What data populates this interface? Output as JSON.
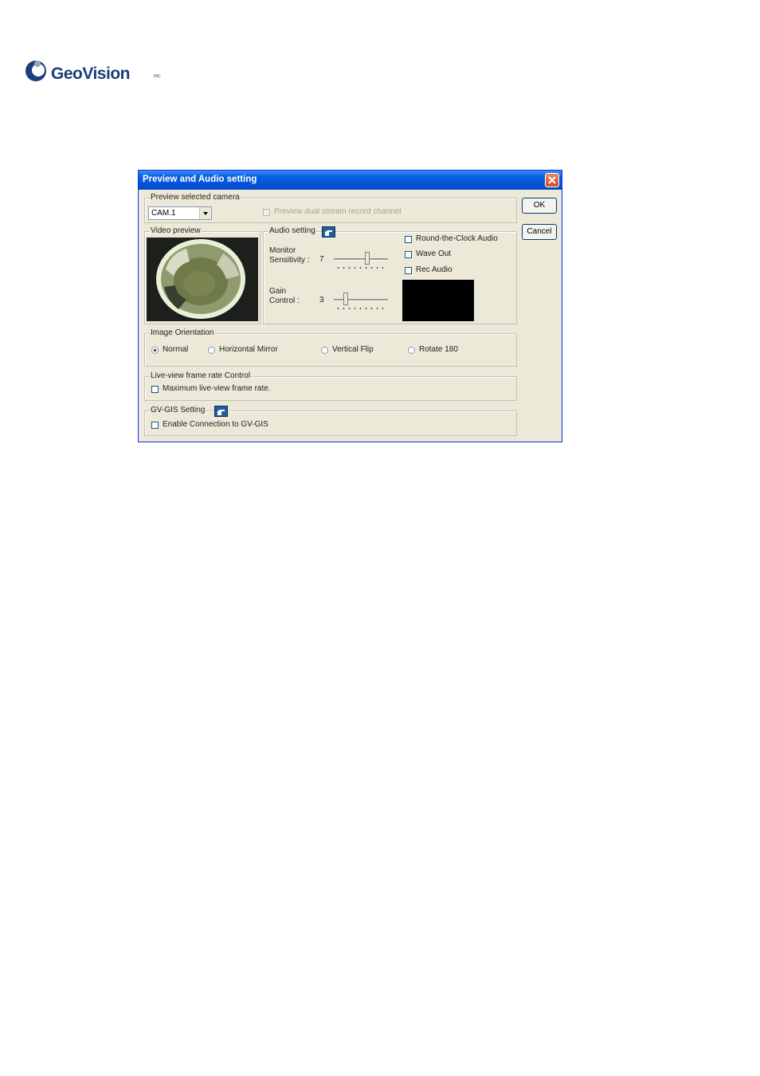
{
  "logo": {
    "text": "GeoVision",
    "tm": "INC"
  },
  "dialog": {
    "title": "Preview and Audio setting",
    "buttons": {
      "ok": "OK",
      "cancel": "Cancel"
    },
    "preview_camera": {
      "group_title": "Preview selected camera",
      "camera_value": "CAM.1",
      "dual_stream_label": "Preview dual stream record channel"
    },
    "video_preview": {
      "group_title": "Video preview"
    },
    "audio": {
      "group_title": "Audio setting",
      "monitor_label_1": "Monitor",
      "monitor_label_2": "Sensitivity :",
      "monitor_value": "7",
      "gain_label_1": "Gain",
      "gain_label_2": "Control :",
      "gain_value": "3",
      "round_clock": "Round-the-Clock Audio",
      "wave_out": "Wave Out",
      "rec_audio": "Rec Audio"
    },
    "orientation": {
      "group_title": "Image Orientation",
      "options": [
        "Normal",
        "Horizontal Mirror",
        "Vertical Flip",
        "Rotate 180"
      ],
      "selected": "Normal"
    },
    "frame_rate": {
      "group_title": "Live-view frame rate Control",
      "max_label": "Maximum live-view frame rate."
    },
    "gis": {
      "group_title": "GV-GIS Setting",
      "enable_label": "Enable Connection to GV-GIS"
    }
  }
}
